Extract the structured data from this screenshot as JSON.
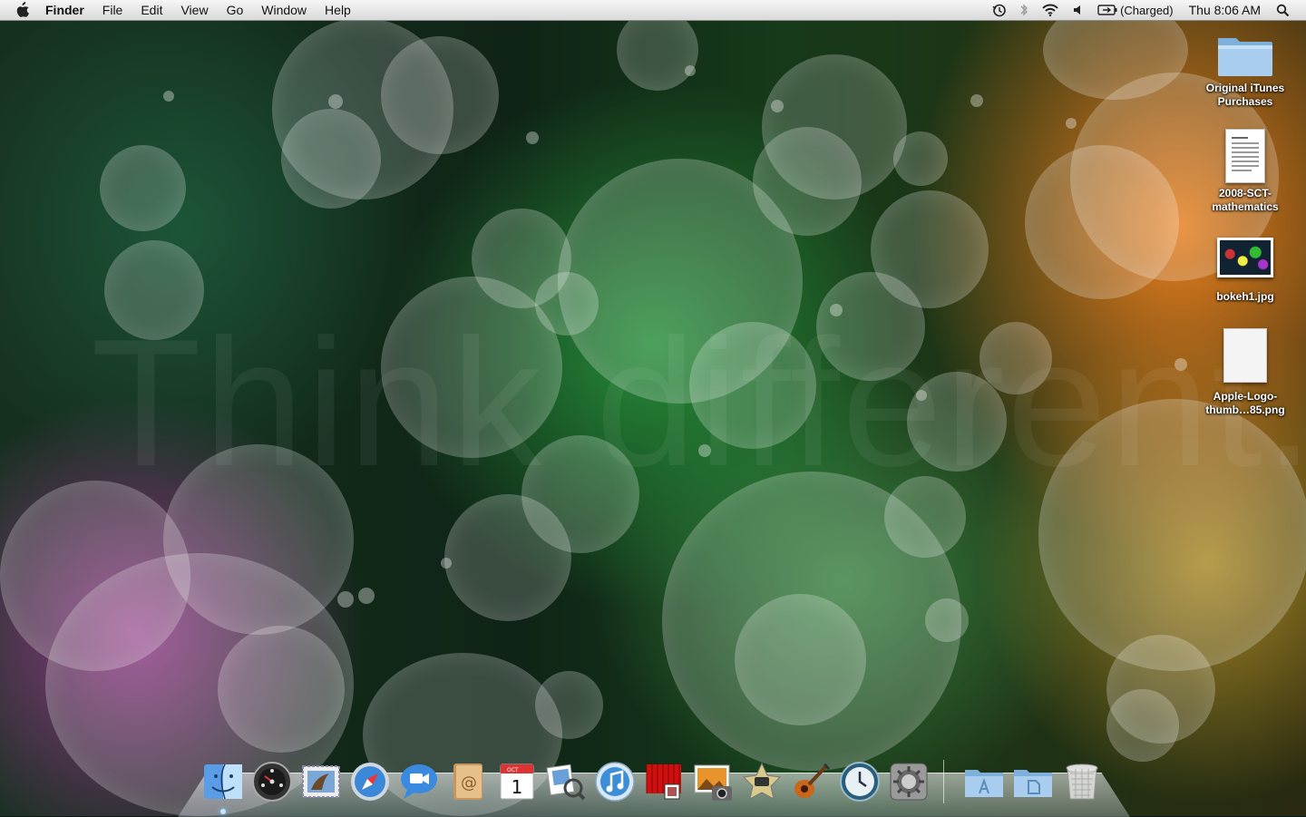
{
  "menubar": {
    "app_name": "Finder",
    "menus": [
      "File",
      "Edit",
      "View",
      "Go",
      "Window",
      "Help"
    ],
    "status": {
      "battery_text": "(Charged)",
      "clock": "Thu 8:06 AM"
    }
  },
  "wallpaper": {
    "tagline": "Think different."
  },
  "desktop_icons": [
    {
      "label_lines": [
        "Original iTunes",
        "Purchases"
      ],
      "icon": "folder-icon"
    },
    {
      "label_lines": [
        "2008-SCT-",
        "mathematics"
      ],
      "icon": "document-icon"
    },
    {
      "label_lines": [
        "bokeh1.jpg"
      ],
      "icon": "image-icon"
    },
    {
      "label_lines": [
        "Apple-Logo-",
        "thumb…85.png"
      ],
      "icon": "png-file-icon"
    }
  ],
  "dock": {
    "apps": [
      "finder-icon",
      "dashboard-icon",
      "mail-icon",
      "safari-icon",
      "ichat-icon",
      "address-book-icon",
      "ical-icon",
      "preview-icon",
      "itunes-icon",
      "front-row-icon",
      "iphoto-icon",
      "imovie-icon",
      "garageband-icon",
      "time-machine-icon",
      "system-preferences-icon"
    ],
    "calendar": {
      "month": "OCT",
      "day": "1"
    },
    "stacks": [
      "applications-stack-icon",
      "documents-stack-icon",
      "trash-icon"
    ]
  },
  "colors": {
    "menubar": "#e6e6e6",
    "folder_blue": "#8fb8dd"
  }
}
